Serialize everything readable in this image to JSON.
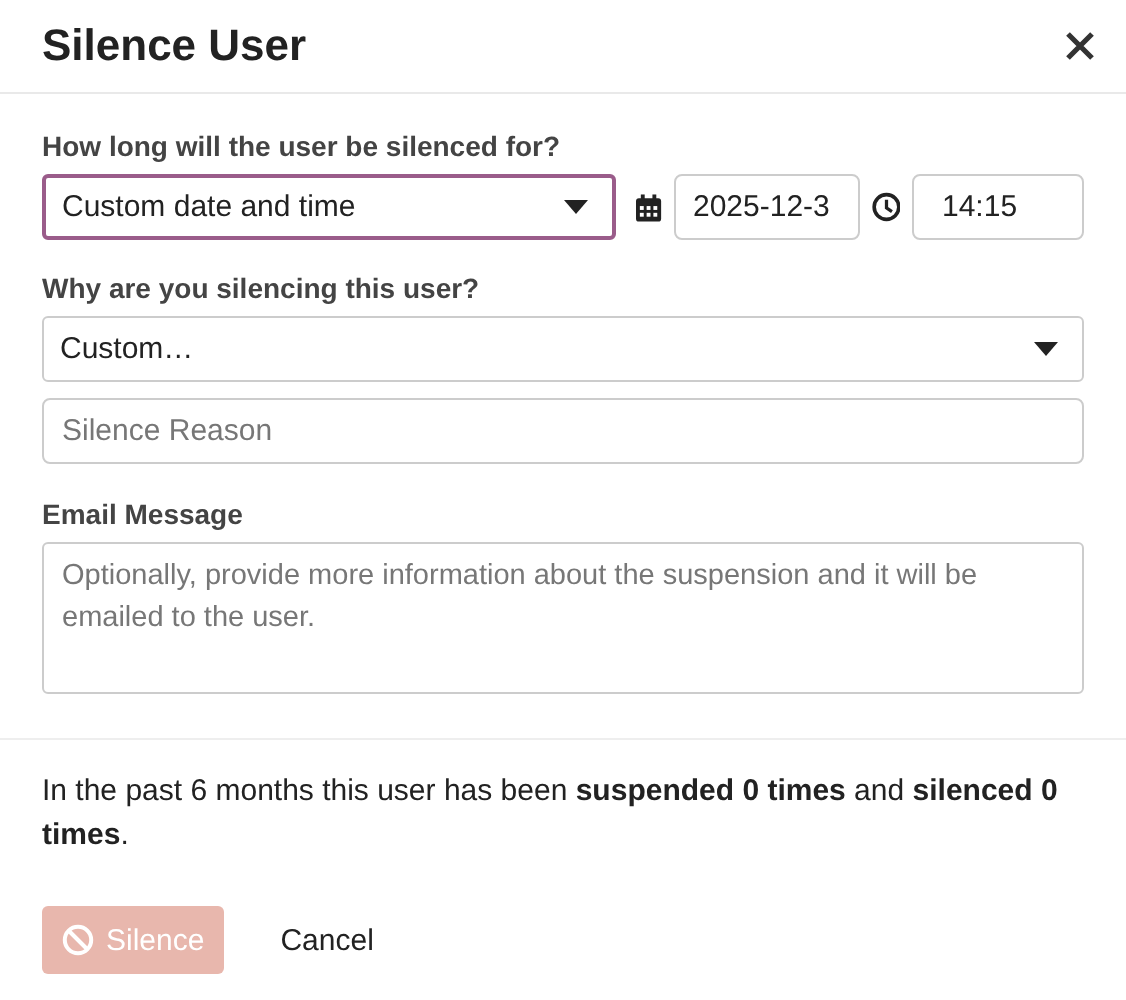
{
  "dialog": {
    "title": "Silence User"
  },
  "duration": {
    "label": "How long will the user be silenced for?",
    "value": "Custom date and time",
    "focused": true,
    "date": "2025-12-3",
    "time": "14:15"
  },
  "reason": {
    "label": "Why are you silencing this user?",
    "value": "Custom…",
    "placeholder": "Silence Reason"
  },
  "email": {
    "label": "Email Message",
    "placeholder": "Optionally, provide more information about the suspension and it will be emailed to the user."
  },
  "history": "In the past 6 months this user has been **suspended 0 times** and **silenced 0 times**.",
  "buttons": [
    {
      "label": "Silence",
      "kind": "primary",
      "disabled": true
    },
    {
      "label": "Cancel",
      "kind": "flat",
      "disabled": false
    }
  ]
}
